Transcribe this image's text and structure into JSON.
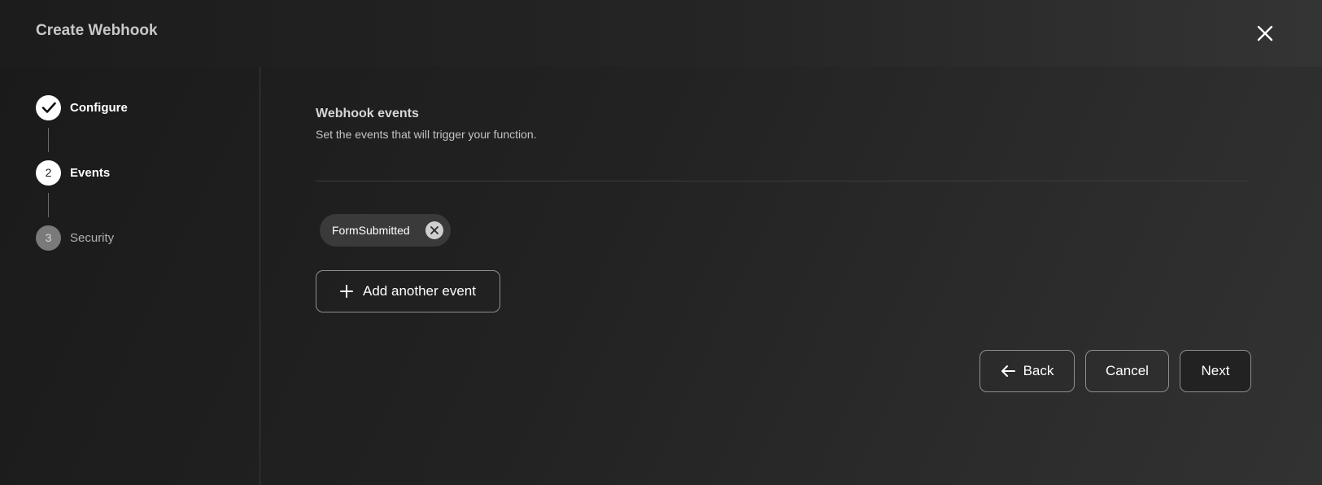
{
  "header": {
    "title": "Create Webhook",
    "close_icon": "close-icon"
  },
  "steps": [
    {
      "label": "Configure",
      "number": "",
      "status": "complete",
      "icon": "checkmark-icon"
    },
    {
      "label": "Events",
      "number": "2",
      "status": "active"
    },
    {
      "label": "Security",
      "number": "3",
      "status": "pending"
    }
  ],
  "main": {
    "title": "Webhook events",
    "subtitle": "Set the events that will trigger your function.",
    "events": [
      {
        "label": "FormSubmitted",
        "remove_icon": "remove-circle-icon"
      }
    ],
    "add_event_label": "Add another event"
  },
  "footer": {
    "back_label": "Back",
    "cancel_label": "Cancel",
    "next_label": "Next"
  },
  "colors": {
    "background": "#222222",
    "text": "#ffffff",
    "muted_text": "#b0b0b0",
    "border": "#8e8e8e"
  }
}
